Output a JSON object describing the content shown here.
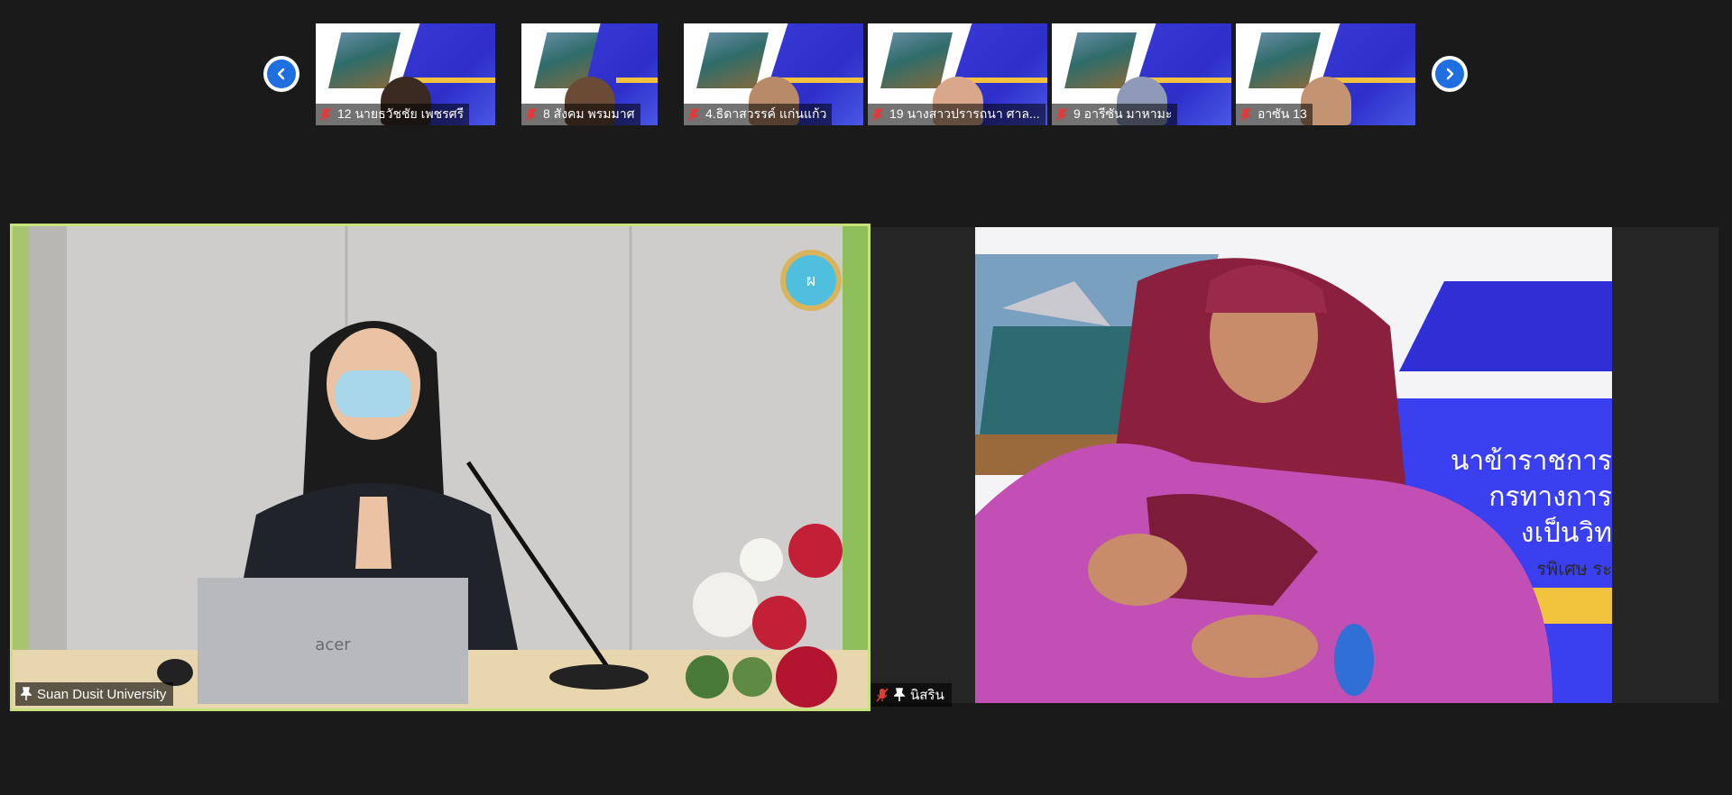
{
  "strip": {
    "prev_label": "previous",
    "next_label": "next",
    "participants": [
      {
        "name": "12 นายธวัชชัย เพชรศรี",
        "muted": true,
        "skin": "#3a2a22"
      },
      {
        "name": "8 สังคม พรมมาศ",
        "muted": true,
        "skin": "#6b4a36"
      },
      {
        "name": "4.ธิดาสวรรค์ แก่นแก้ว",
        "muted": true,
        "skin": "#b88a6a"
      },
      {
        "name": "19 นางสาวปรารถนา ศาล...",
        "muted": true,
        "skin": "#d9a88a"
      },
      {
        "name": "9 อารีซัน มาหามะ",
        "muted": true,
        "skin": "#8f9ab8"
      },
      {
        "name": "อาซัน 13",
        "muted": true,
        "skin": "#c49472"
      }
    ]
  },
  "main": {
    "left": {
      "name": "Suan Dusit University",
      "pinned": true,
      "laptop_brand": "acer",
      "active_speaker": true
    },
    "right": {
      "name": "นิสริน",
      "pinned": true,
      "muted": true,
      "banner_lines": [
        "นาข้าราชการ",
        "กรทางการ",
        "งเป็นวิท",
        "รพิเศษ ระ"
      ]
    }
  },
  "colors": {
    "active_border": "#c8e27a",
    "accent": "#1f6fe0",
    "muted_red": "#e03a3a"
  }
}
